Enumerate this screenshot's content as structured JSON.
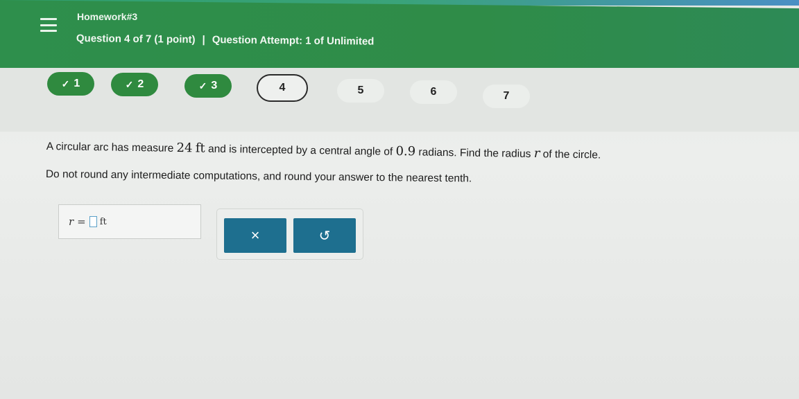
{
  "header": {
    "menu_icon": "hamburger-menu-icon",
    "assignment_title": "Homework#3",
    "question_info": "Question 4 of 7 (1 point)",
    "separator": "|",
    "attempt_info": "Question Attempt: 1 of Unlimited"
  },
  "nav": {
    "questions": [
      {
        "label": "1",
        "status": "completed",
        "mark": "✓"
      },
      {
        "label": "2",
        "status": "completed",
        "mark": "✓"
      },
      {
        "label": "3",
        "status": "completed",
        "mark": "✓"
      },
      {
        "label": "4",
        "status": "current"
      },
      {
        "label": "5",
        "status": "unanswered"
      },
      {
        "label": "6",
        "status": "unanswered"
      },
      {
        "label": "7",
        "status": "unanswered"
      }
    ]
  },
  "question": {
    "text_before_arc": "A circular arc has measure ",
    "arc_value": "24",
    "arc_unit": "ft",
    "text_mid": " and is intercepted by a central angle of ",
    "angle_value": "0.9",
    "text_after_angle": " radians. Find the radius ",
    "radius_var": "r",
    "text_end": " of the circle.",
    "instruction": "Do not round any intermediate computations, and round your answer to the nearest tenth."
  },
  "answer": {
    "variable": "r",
    "equals": "=",
    "value": "",
    "unit": "ft"
  },
  "actions": {
    "clear_label": "×",
    "undo_label": "↺"
  },
  "colors": {
    "header_green": "#2e8f4c",
    "completed_green": "#2f8a3f",
    "action_blue": "#1e6f8f"
  }
}
